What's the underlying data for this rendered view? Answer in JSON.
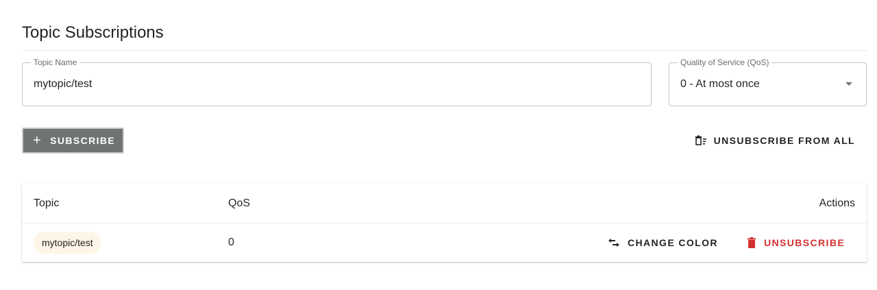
{
  "page": {
    "title": "Topic Subscriptions"
  },
  "form": {
    "topic_label": "Topic Name",
    "topic_value": "mytopic/test",
    "qos_label": "Quality of Service (QoS)",
    "qos_selected": "0 - At most once"
  },
  "toolbar": {
    "subscribe_label": "SUBSCRIBE",
    "subscribe_icon": "plus-icon",
    "unsubscribe_all_label": "UNSUBSCRIBE FROM ALL",
    "unsubscribe_all_icon": "delete-sweep-icon"
  },
  "table": {
    "columns": [
      "Topic",
      "QoS",
      "Actions"
    ],
    "rows": [
      {
        "topic": "mytopic/test",
        "qos": "0",
        "change_color_label": "CHANGE COLOR",
        "unsubscribe_label": "UNSUBSCRIBE"
      }
    ]
  },
  "colors": {
    "subscribe_bg": "#6f7373",
    "unsubscribe": "#d32f2f",
    "chip_bg": "#fdf6e8"
  }
}
